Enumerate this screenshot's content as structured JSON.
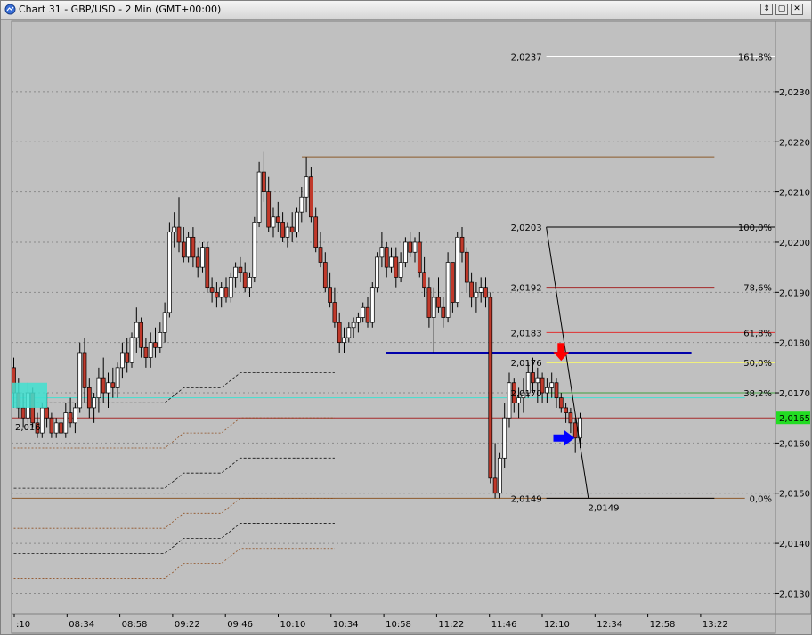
{
  "window": {
    "title": "Chart 31 - GBP/USD - 2 Min (GMT+00:00)",
    "buttons": [
      "⇕",
      "▢",
      "✕"
    ]
  },
  "chart_data": {
    "type": "candlestick",
    "symbol": "GBP/USD",
    "timeframe": "2 Min",
    "ylim": [
      2.0126,
      2.0244
    ],
    "y_ticks": [
      "2,0130",
      "2,0140",
      "2,0150",
      "2,0160",
      "2,0170",
      "2,0180",
      "2,0190",
      "2,0200",
      "2,0210",
      "2,0220",
      "2,0230"
    ],
    "x_ticks": [
      ":10",
      "08:34",
      "08:58",
      "09:22",
      "09:46",
      "10:10",
      "10:34",
      "10:58",
      "11:22",
      "11:46",
      "12:10",
      "12:34",
      "12:58",
      "13:22"
    ],
    "last_price": "2,0165",
    "grid": true,
    "candles_start_slot": -3,
    "candles": [
      [
        2.0175,
        2.0177,
        2.0167,
        2.017
      ],
      [
        2.017,
        2.0173,
        2.0165,
        2.0167
      ],
      [
        2.0167,
        2.017,
        2.0163,
        2.0165
      ],
      [
        2.0165,
        2.0172,
        2.0164,
        2.017
      ],
      [
        2.017,
        2.0171,
        2.0163,
        2.0164
      ],
      [
        2.0164,
        2.0166,
        2.0161,
        2.0162
      ],
      [
        2.0162,
        2.0168,
        2.0161,
        2.0167
      ],
      [
        2.0167,
        2.017,
        2.0163,
        2.0165
      ],
      [
        2.0165,
        2.0166,
        2.0161,
        2.0162
      ],
      [
        2.0162,
        2.0165,
        2.0161,
        2.0164
      ],
      [
        2.0164,
        2.0164,
        2.016,
        2.0162
      ],
      [
        2.0162,
        2.0168,
        2.0161,
        2.0166
      ],
      [
        2.0166,
        2.0169,
        2.0163,
        2.0164
      ],
      [
        2.0164,
        2.0168,
        2.0162,
        2.0167
      ],
      [
        2.0167,
        2.018,
        2.0166,
        2.0178
      ],
      [
        2.0178,
        2.0181,
        2.0168,
        2.0171
      ],
      [
        2.0171,
        2.0173,
        2.0165,
        2.0167
      ],
      [
        2.0167,
        2.017,
        2.0164,
        2.0169
      ],
      [
        2.0169,
        2.0175,
        2.0166,
        2.0173
      ],
      [
        2.0173,
        2.0177,
        2.0168,
        2.017
      ],
      [
        2.017,
        2.0174,
        2.0167,
        2.0172
      ],
      [
        2.0172,
        2.0175,
        2.0169,
        2.0171
      ],
      [
        2.0171,
        2.0176,
        2.0169,
        2.0175
      ],
      [
        2.0175,
        2.018,
        2.0173,
        2.0178
      ],
      [
        2.0178,
        2.0181,
        2.0174,
        2.0176
      ],
      [
        2.0176,
        2.0182,
        2.0175,
        2.0181
      ],
      [
        2.0181,
        2.0187,
        2.0178,
        2.0184
      ],
      [
        2.0184,
        2.0185,
        2.0177,
        2.0179
      ],
      [
        2.0179,
        2.0181,
        2.0175,
        2.0177
      ],
      [
        2.0177,
        2.0182,
        2.0175,
        2.018
      ],
      [
        2.018,
        2.0183,
        2.0177,
        2.0179
      ],
      [
        2.0179,
        2.0184,
        2.0178,
        2.0182
      ],
      [
        2.0182,
        2.0188,
        2.018,
        2.0186
      ],
      [
        2.0186,
        2.0204,
        2.0185,
        2.0202
      ],
      [
        2.0202,
        2.0206,
        2.0199,
        2.0203
      ],
      [
        2.0203,
        2.0209,
        2.0198,
        2.02
      ],
      [
        2.02,
        2.0203,
        2.0196,
        2.0197
      ],
      [
        2.0197,
        2.0202,
        2.0196,
        2.0201
      ],
      [
        2.0201,
        2.0203,
        2.0195,
        2.0197
      ],
      [
        2.0197,
        2.0199,
        2.0193,
        2.0195
      ],
      [
        2.0195,
        2.02,
        2.0194,
        2.0199
      ],
      [
        2.0199,
        2.02,
        2.019,
        2.0191
      ],
      [
        2.0191,
        2.0193,
        2.0188,
        2.019
      ],
      [
        2.019,
        2.0192,
        2.0187,
        2.0189
      ],
      [
        2.0189,
        2.0192,
        2.0187,
        2.0191
      ],
      [
        2.0191,
        2.0193,
        2.0188,
        2.0189
      ],
      [
        2.0189,
        2.0194,
        2.0188,
        2.0193
      ],
      [
        2.0193,
        2.0196,
        2.0191,
        2.0195
      ],
      [
        2.0195,
        2.0197,
        2.0192,
        2.0194
      ],
      [
        2.0194,
        2.0196,
        2.019,
        2.0191
      ],
      [
        2.0191,
        2.0194,
        2.0189,
        2.0193
      ],
      [
        2.0193,
        2.0205,
        2.0192,
        2.0204
      ],
      [
        2.0204,
        2.0216,
        2.0203,
        2.0214
      ],
      [
        2.0214,
        2.0218,
        2.0208,
        2.021
      ],
      [
        2.021,
        2.0213,
        2.0202,
        2.0203
      ],
      [
        2.0203,
        2.0207,
        2.0201,
        2.0205
      ],
      [
        2.0205,
        2.0208,
        2.0202,
        2.0204
      ],
      [
        2.0204,
        2.0206,
        2.02,
        2.0201
      ],
      [
        2.0201,
        2.0204,
        2.0199,
        2.0203
      ],
      [
        2.0203,
        2.0206,
        2.02,
        2.0202
      ],
      [
        2.0202,
        2.0207,
        2.0201,
        2.0206
      ],
      [
        2.0206,
        2.0211,
        2.0204,
        2.0209
      ],
      [
        2.0209,
        2.0217,
        2.0206,
        2.0213
      ],
      [
        2.0213,
        2.0215,
        2.0204,
        2.0205
      ],
      [
        2.0205,
        2.0207,
        2.0198,
        2.0199
      ],
      [
        2.0199,
        2.0202,
        2.0195,
        2.0196
      ],
      [
        2.0196,
        2.0198,
        2.019,
        2.0191
      ],
      [
        2.0191,
        2.0194,
        2.0187,
        2.0188
      ],
      [
        2.0188,
        2.0191,
        2.0183,
        2.0184
      ],
      [
        2.0184,
        2.0186,
        2.0178,
        2.018
      ],
      [
        2.018,
        2.0183,
        2.0178,
        2.0181
      ],
      [
        2.0181,
        2.0184,
        2.018,
        2.0183
      ],
      [
        2.0183,
        2.0185,
        2.0181,
        2.0184
      ],
      [
        2.0184,
        2.0186,
        2.0182,
        2.0185
      ],
      [
        2.0185,
        2.0188,
        2.0184,
        2.0187
      ],
      [
        2.0187,
        2.0189,
        2.0183,
        2.0184
      ],
      [
        2.0184,
        2.0192,
        2.0183,
        2.0191
      ],
      [
        2.0191,
        2.0198,
        2.019,
        2.0197
      ],
      [
        2.0197,
        2.0202,
        2.0195,
        2.0199
      ],
      [
        2.0199,
        2.02,
        2.0193,
        2.0195
      ],
      [
        2.0195,
        2.0199,
        2.0194,
        2.0197
      ],
      [
        2.0197,
        2.0199,
        2.0191,
        2.0193
      ],
      [
        2.0193,
        2.0198,
        2.0192,
        2.0196
      ],
      [
        2.0196,
        2.0201,
        2.0195,
        2.02
      ],
      [
        2.02,
        2.0202,
        2.0197,
        2.0198
      ],
      [
        2.0198,
        2.0201,
        2.0196,
        2.02
      ],
      [
        2.02,
        2.0202,
        2.0193,
        2.0194
      ],
      [
        2.0194,
        2.0197,
        2.0189,
        2.0191
      ],
      [
        2.0191,
        2.0193,
        2.0183,
        2.0185
      ],
      [
        2.0185,
        2.0191,
        2.0178,
        2.0189
      ],
      [
        2.0189,
        2.0193,
        2.0186,
        2.0187
      ],
      [
        2.0187,
        2.0189,
        2.0183,
        2.0185
      ],
      [
        2.0185,
        2.0198,
        2.0184,
        2.0196
      ],
      [
        2.0196,
        2.0191,
        2.0186,
        2.0188
      ],
      [
        2.0188,
        2.0202,
        2.0187,
        2.0201
      ],
      [
        2.0201,
        2.0203,
        2.0196,
        2.0198
      ],
      [
        2.0198,
        2.0199,
        2.019,
        2.0192
      ],
      [
        2.0192,
        2.0194,
        2.0187,
        2.0189
      ],
      [
        2.0189,
        2.0192,
        2.0186,
        2.019
      ],
      [
        2.019,
        2.0193,
        2.0188,
        2.0191
      ],
      [
        2.0191,
        2.0193,
        2.0187,
        2.0189
      ],
      [
        2.0189,
        2.019,
        2.0152,
        2.0153
      ],
      [
        2.0153,
        2.016,
        2.0149,
        2.015
      ],
      [
        2.015,
        2.0158,
        2.0149,
        2.0157
      ],
      [
        2.0157,
        2.0168,
        2.0155,
        2.0165
      ],
      [
        2.0165,
        2.0174,
        2.0163,
        2.0172
      ],
      [
        2.0172,
        2.0173,
        2.0166,
        2.0168
      ],
      [
        2.0168,
        2.0171,
        2.0165,
        2.0169
      ],
      [
        2.0169,
        2.0173,
        2.0166,
        2.017
      ],
      [
        2.017,
        2.0176,
        2.0169,
        2.0174
      ],
      [
        2.0174,
        2.0177,
        2.017,
        2.0172
      ],
      [
        2.0172,
        2.0175,
        2.0168,
        2.0173
      ],
      [
        2.0173,
        2.0174,
        2.0168,
        2.017
      ],
      [
        2.017,
        2.0173,
        2.0168,
        2.0171
      ],
      [
        2.0171,
        2.0174,
        2.0169,
        2.0172
      ],
      [
        2.0172,
        2.0173,
        2.0167,
        2.0169
      ],
      [
        2.0169,
        2.017,
        2.0166,
        2.0167
      ],
      [
        2.0167,
        2.0168,
        2.0164,
        2.0166
      ],
      [
        2.0166,
        2.0167,
        2.0162,
        2.0164
      ],
      [
        2.0164,
        2.0165,
        2.0158,
        2.0161
      ],
      [
        2.0161,
        2.0166,
        2.0159,
        2.0165
      ]
    ],
    "horizontal_lines": [
      {
        "y": 2.0149,
        "x1": 0.0,
        "x2": 0.96,
        "color": "#8b5a2b",
        "dash": false
      },
      {
        "y": 2.0165,
        "x1": 0.0,
        "x2": 1.0,
        "color": "#a52a2a",
        "dash": false
      },
      {
        "y": 2.0169,
        "x1": 0.0,
        "x2": 0.96,
        "color": "#40e0d0",
        "dash": false
      },
      {
        "y": 2.0178,
        "x1": 0.49,
        "x2": 0.89,
        "color": "#0000aa",
        "dash": false,
        "width": 2
      },
      {
        "y": 2.0176,
        "x1": 0.7,
        "x2": 1.0,
        "color": "#ffff66",
        "dash": false
      },
      {
        "y": 2.0182,
        "x1": 0.7,
        "x2": 1.0,
        "color": "#e03030",
        "dash": false
      },
      {
        "y": 2.0191,
        "x1": 0.7,
        "x2": 0.92,
        "color": "#a52a2a",
        "dash": false
      },
      {
        "y": 2.017,
        "x1": 0.7,
        "x2": 1.0,
        "color": "#40a040",
        "dash": false
      },
      {
        "y": 2.0203,
        "x1": 0.7,
        "x2": 1.0,
        "color": "#000000",
        "dash": false
      },
      {
        "y": 2.0237,
        "x1": 0.7,
        "x2": 1.0,
        "color": "#ffffff",
        "dash": false
      },
      {
        "y": 2.0149,
        "x1": 0.7,
        "x2": 0.92,
        "color": "#000000",
        "dash": false
      },
      {
        "y": 2.0217,
        "x1": 0.38,
        "x2": 0.92,
        "color": "#8b5a2b",
        "dash": false
      }
    ],
    "fib_levels": [
      {
        "price": "2,0237",
        "pct": "161,8%",
        "y": 2.0237
      },
      {
        "price": "2,0203",
        "pct": "100,0%",
        "y": 2.0203
      },
      {
        "price": "2,0192",
        "pct": "78,6%",
        "y": 2.0191
      },
      {
        "price": "2,0183",
        "pct": "61,8%",
        "y": 2.0182
      },
      {
        "price": "2,0176",
        "pct": "50,0%",
        "y": 2.0176
      },
      {
        "price": "2,0170",
        "pct": "38,2%",
        "y": 2.017
      },
      {
        "price": "2,0149",
        "pct": "0,0%",
        "y": 2.0149
      }
    ],
    "annotations": [
      {
        "text": "2,016",
        "y": 2.0165,
        "x": 0.0
      },
      {
        "text": "2,0149",
        "y": 2.0149,
        "x": 0.75
      }
    ],
    "arrows": [
      {
        "direction": "down",
        "color": "#ff0000",
        "slot": 113,
        "y": 2.0176
      },
      {
        "direction": "right",
        "color": "#0000ff",
        "slot": 117,
        "y": 2.0161
      }
    ]
  }
}
